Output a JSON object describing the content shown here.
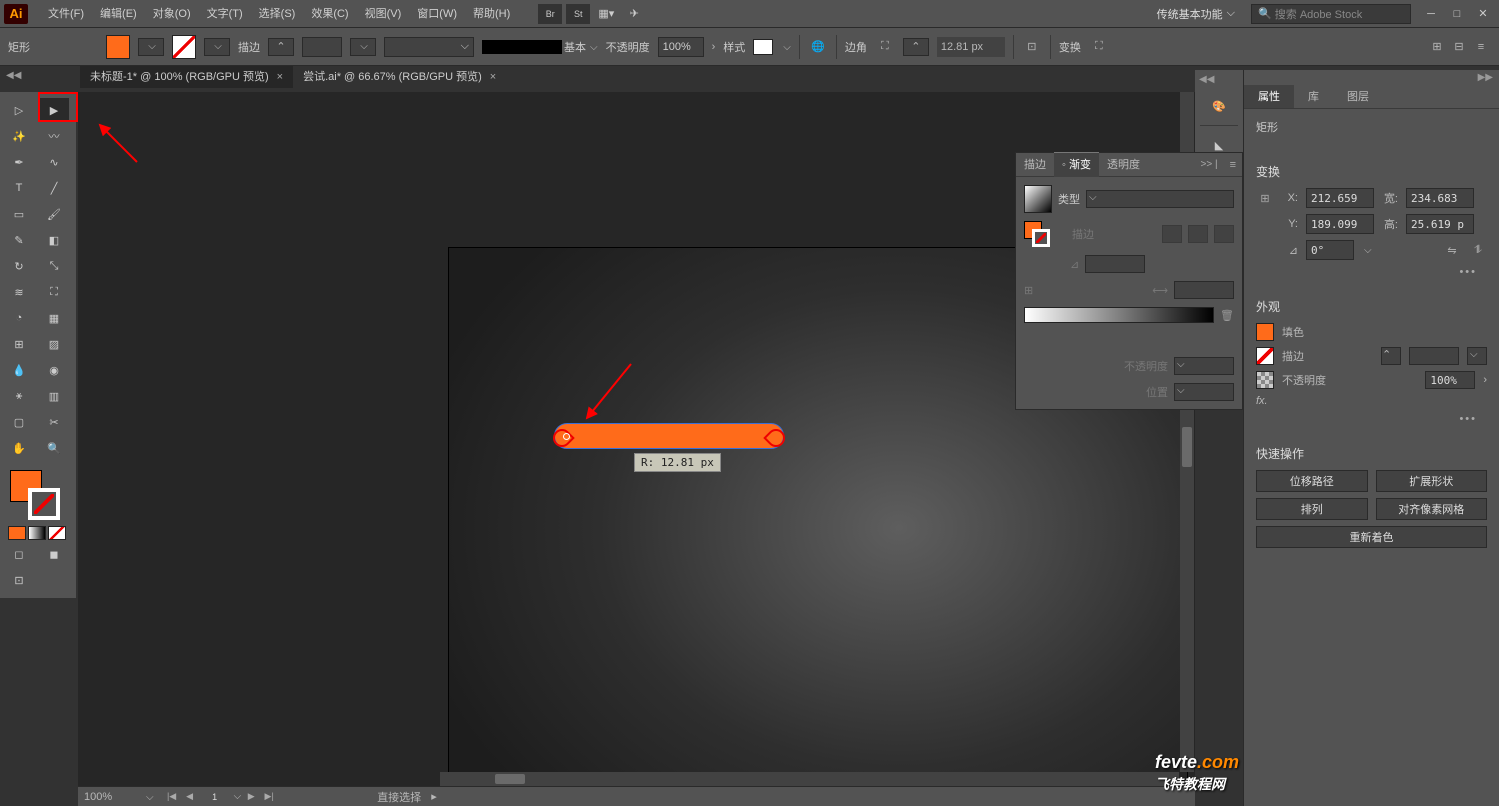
{
  "app_logo": "Ai",
  "menus": [
    "文件(F)",
    "编辑(E)",
    "对象(O)",
    "文字(T)",
    "选择(S)",
    "效果(C)",
    "视图(V)",
    "窗口(W)",
    "帮助(H)"
  ],
  "menu_icons": [
    "Br",
    "St"
  ],
  "workspace": "传统基本功能",
  "search_placeholder": "搜索 Adobe Stock",
  "control": {
    "shape_label": "矩形",
    "stroke_label": "描边",
    "stroke_width": "",
    "profile_label": "基本",
    "opacity_label": "不透明度",
    "opacity_value": "100%",
    "style_label": "样式",
    "corner_label": "边角",
    "corner_value": "12.81 px",
    "transform_label": "变换"
  },
  "tabs": [
    {
      "label": "未标题-1* @ 100% (RGB/GPU 预览)",
      "active": true
    },
    {
      "label": "尝试.ai* @ 66.67% (RGB/GPU 预览)",
      "active": false
    }
  ],
  "canvas": {
    "tooltip": "R: 12.81 px"
  },
  "gradient_panel": {
    "tabs": [
      "描边",
      "渐变",
      "透明度"
    ],
    "ext": ">> |",
    "type_label": "类型",
    "stroke_label": "描边",
    "angle_icon": "⊿",
    "ratio_icon": "⟷",
    "opacity_label": "不透明度",
    "position_label": "位置"
  },
  "properties": {
    "tabs": [
      "属性",
      "库",
      "图层"
    ],
    "selection": "矩形",
    "transform_title": "变换",
    "x_label": "X:",
    "y_label": "Y:",
    "w_label": "宽:",
    "h_label": "高:",
    "x_val": "212.659",
    "y_val": "189.099",
    "w_val": "234.683",
    "h_val": "25.619 p",
    "angle_label": "⊿",
    "angle_val": "0°",
    "appearance_title": "外观",
    "fill_label": "填色",
    "stroke_label": "描边",
    "opacity_label": "不透明度",
    "opacity_val": "100%",
    "fx_label": "fx.",
    "quick_title": "快速操作",
    "qa1": "位移路径",
    "qa2": "扩展形状",
    "qa3": "排列",
    "qa4": "对齐像素网格",
    "qa5": "重新着色"
  },
  "status": {
    "zoom": "100%",
    "page": "1",
    "tool": "直接选择"
  },
  "watermark": "fevte.com\n飞特教程网"
}
